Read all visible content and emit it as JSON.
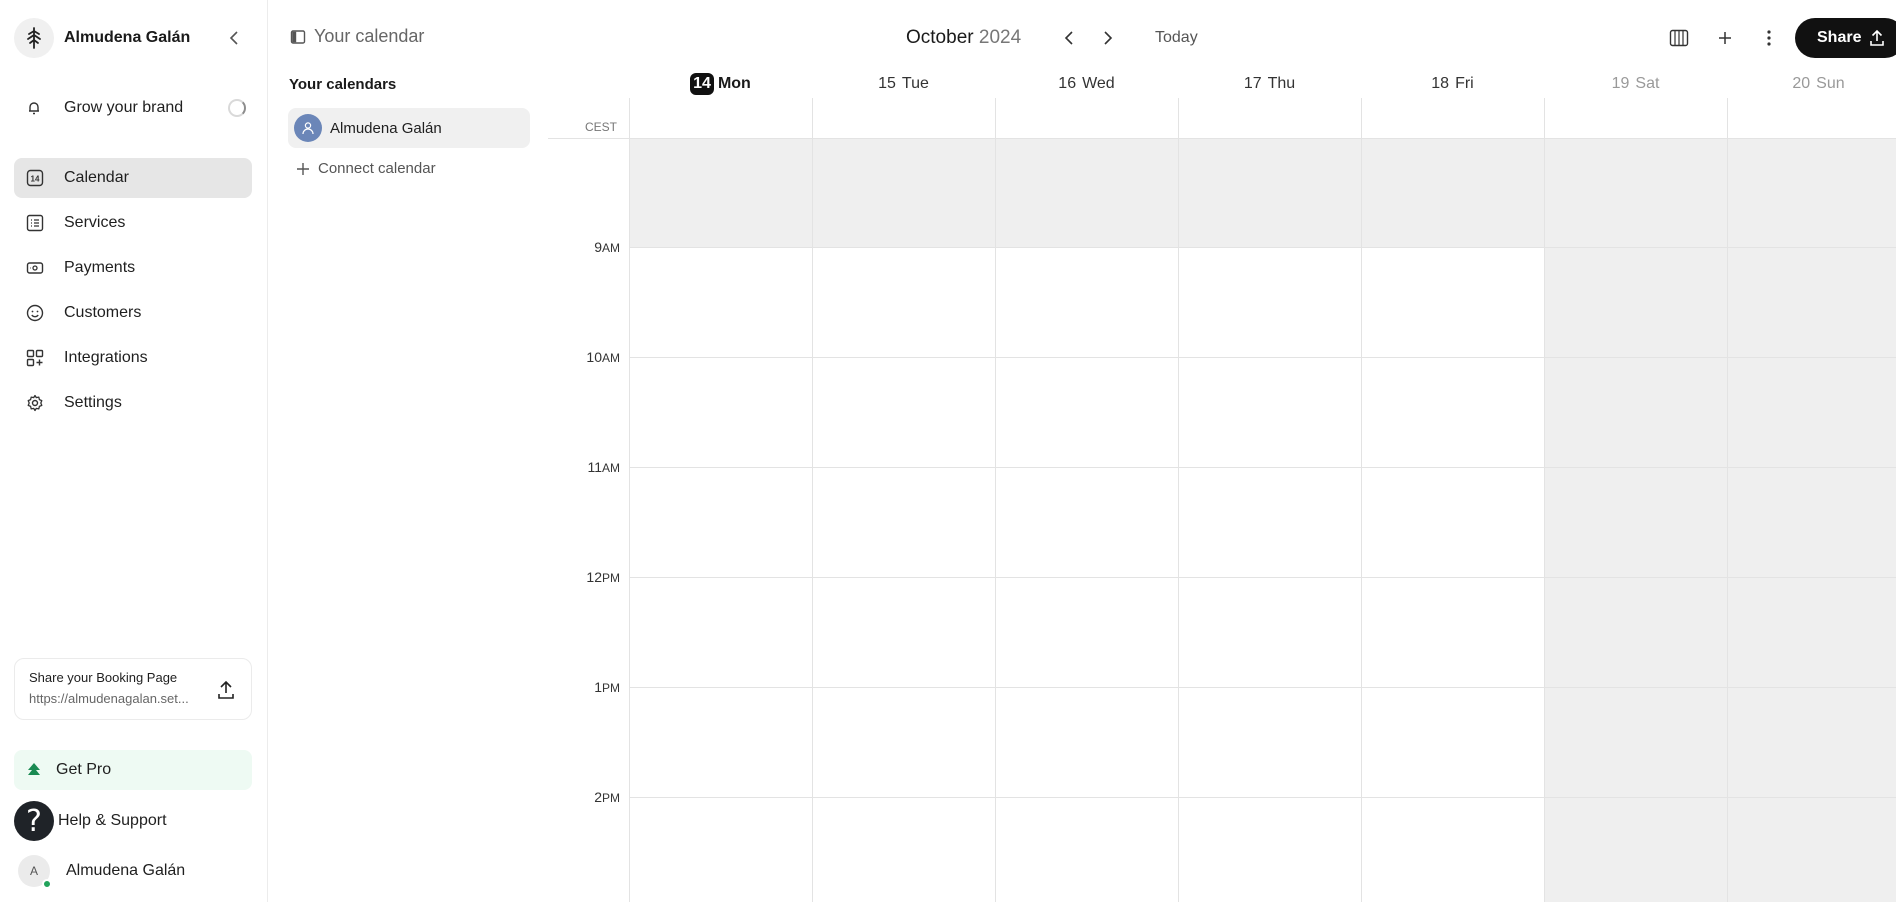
{
  "sidebar": {
    "user_name": "Almudena Galán",
    "grow_label": "Grow your brand",
    "nav": [
      {
        "label": "Calendar",
        "icon": "calendar-icon",
        "active": true
      },
      {
        "label": "Services",
        "icon": "list-icon",
        "active": false
      },
      {
        "label": "Payments",
        "icon": "money-icon",
        "active": false
      },
      {
        "label": "Customers",
        "icon": "smiley-icon",
        "active": false
      },
      {
        "label": "Integrations",
        "icon": "apps-icon",
        "active": false
      },
      {
        "label": "Settings",
        "icon": "gear-icon",
        "active": false
      }
    ],
    "calendar_icon_number": "14",
    "share_card": {
      "title": "Share your Booking Page",
      "url": "https://almudenagalan.set..."
    },
    "get_pro": "Get Pro",
    "help": "Help & Support",
    "help_glyph": "?",
    "footer_user": "Almudena Galán",
    "footer_initial": "A"
  },
  "calendars": {
    "title": "Your calendar",
    "section": "Your calendars",
    "item": "Almudena Galán",
    "connect": "Connect calendar"
  },
  "header": {
    "month": "October",
    "year": "2024",
    "today": "Today",
    "share": "Share"
  },
  "days": [
    {
      "num": "14",
      "wd": "Mon",
      "today": true,
      "weekend": false
    },
    {
      "num": "15",
      "wd": "Tue",
      "today": false,
      "weekend": false
    },
    {
      "num": "16",
      "wd": "Wed",
      "today": false,
      "weekend": false
    },
    {
      "num": "17",
      "wd": "Thu",
      "today": false,
      "weekend": false
    },
    {
      "num": "18",
      "wd": "Fri",
      "today": false,
      "weekend": false
    },
    {
      "num": "19",
      "wd": "Sat",
      "today": false,
      "weekend": true
    },
    {
      "num": "20",
      "wd": "Sun",
      "today": false,
      "weekend": true
    }
  ],
  "timezone": "CEST",
  "hours": [
    {
      "h": "9",
      "ap": "AM"
    },
    {
      "h": "10",
      "ap": "AM"
    },
    {
      "h": "11",
      "ap": "AM"
    },
    {
      "h": "12",
      "ap": "PM"
    },
    {
      "h": "1",
      "ap": "PM"
    },
    {
      "h": "2",
      "ap": "PM"
    }
  ]
}
